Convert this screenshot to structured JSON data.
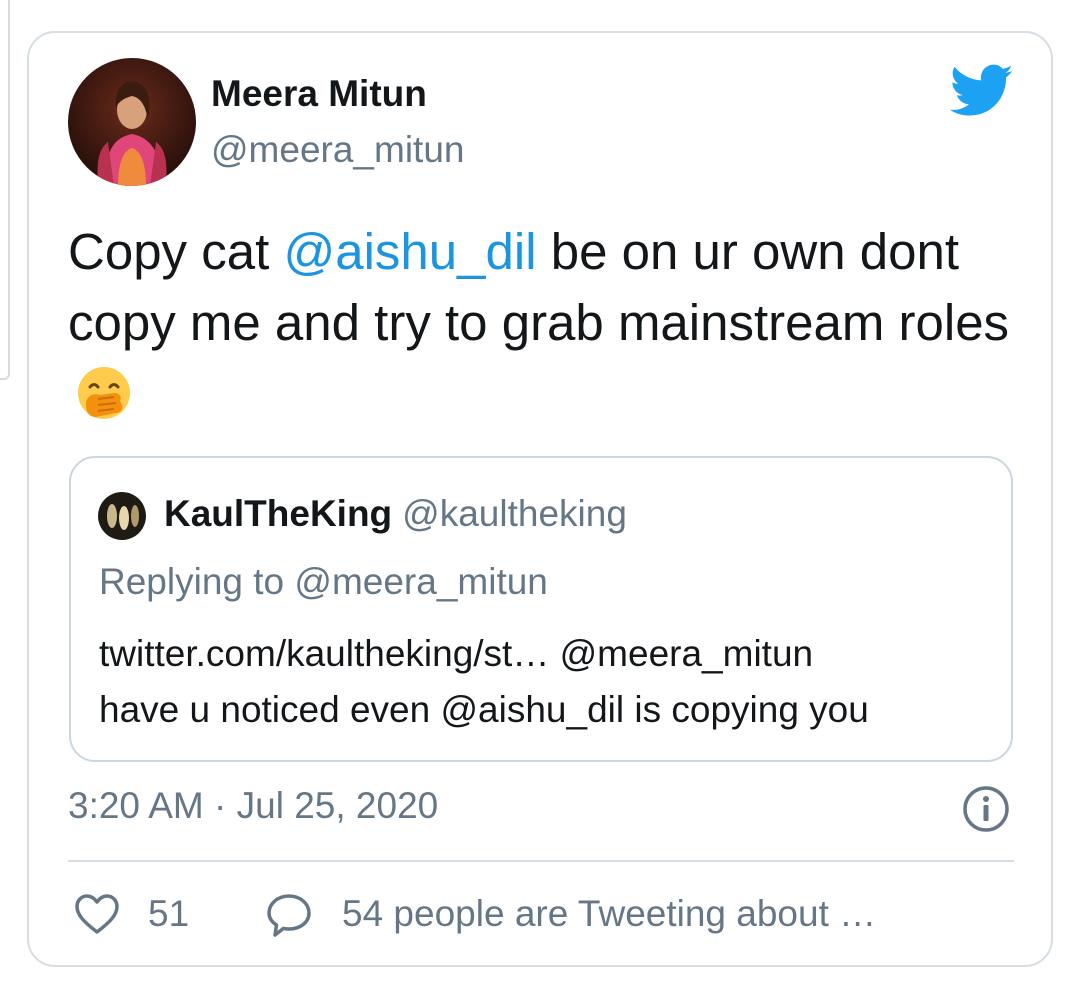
{
  "author": {
    "name": "Meera Mitun",
    "handle": "@meera_mitun"
  },
  "tweet": {
    "text_before": "Copy cat ",
    "mention": "@aishu_dil",
    "text_after": " be on ur own dont copy me and try to grab mainstream roles",
    "emoji": "face-with-hand-over-mouth"
  },
  "quoted_tweet": {
    "name": "KaulTheKing",
    "handle": "@kaultheking",
    "replying_to": "Replying to @meera_mitun",
    "line1": "twitter.com/kaultheking/st… @meera_mitun",
    "line2": "have u noticed even @aishu_dil is copying you"
  },
  "footer": {
    "timestamp": "3:20 AM · Jul 25, 2020",
    "likes": "51",
    "tweeting": "54 people are Tweeting about …"
  },
  "icons": {
    "brand": "twitter-bird-icon",
    "info": "info-icon",
    "like": "heart-icon",
    "reply": "speech-bubble-icon"
  },
  "colors": {
    "brand_blue": "#1da1f2",
    "mention_blue": "#1b95e0",
    "secondary_text": "#657786",
    "primary_text": "#14171a",
    "border": "#d6dde3"
  }
}
